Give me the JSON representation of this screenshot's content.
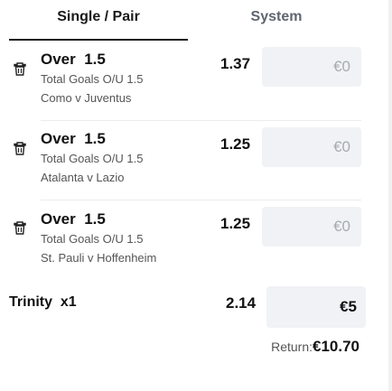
{
  "tabs": {
    "single_pair": "Single / Pair",
    "system": "System"
  },
  "bets": [
    {
      "selection": "Over  1.5",
      "market": "Total Goals O/U 1.5",
      "event": "Como v Juventus",
      "odds": "1.37",
      "stake": "€0"
    },
    {
      "selection": "Over  1.5",
      "market": "Total Goals O/U 1.5",
      "event": "Atalanta v Lazio",
      "odds": "1.25",
      "stake": "€0"
    },
    {
      "selection": "Over  1.5",
      "market": "Total Goals O/U 1.5",
      "event": "St. Pauli v Hoffenheim",
      "odds": "1.25",
      "stake": "€0"
    }
  ],
  "trinity": {
    "label": "Trinity  x1",
    "odds": "2.14",
    "stake": "€5"
  },
  "return": {
    "label": "Return:",
    "value": "€10.70"
  },
  "icons": {
    "remove": "trash-icon"
  }
}
